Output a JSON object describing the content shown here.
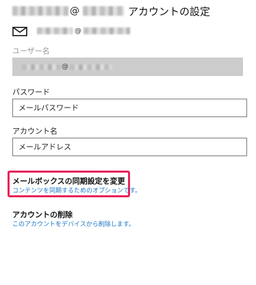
{
  "header": {
    "at": "@",
    "title": "アカウントの設定"
  },
  "account": {
    "at": "@"
  },
  "username": {
    "label": "ユーザー名",
    "at": "@"
  },
  "password": {
    "label": "パスワード",
    "value": "メールパスワード"
  },
  "account_name": {
    "label": "アカウント名",
    "value": "メールアドレス"
  },
  "sync": {
    "title": "メールボックスの同期設定を変更",
    "link": "コンテンツを同期するためのオプションです。",
    "highlight_color": "#e8245a"
  },
  "delete": {
    "title": "アカウントの削除",
    "link": "このアカウントをデバイスから削除します。"
  },
  "icons": [
    "mail-icon"
  ],
  "colors": {
    "link": "#1a73c9",
    "disabled_field": "#cccccc"
  }
}
